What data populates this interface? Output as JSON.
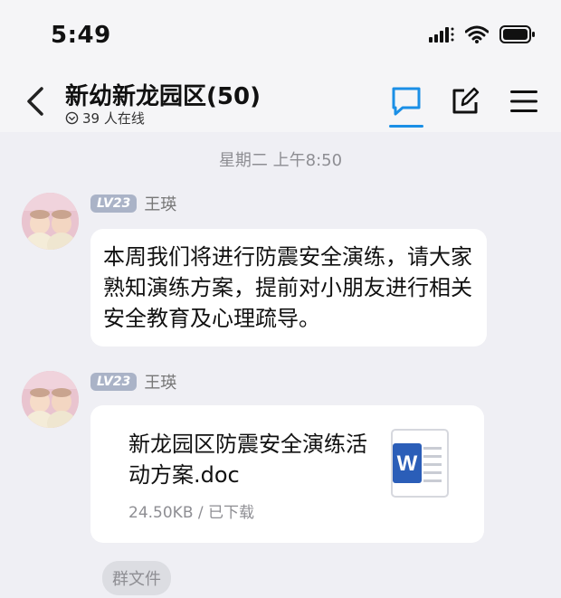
{
  "status_bar": {
    "time": "5:49"
  },
  "header": {
    "title": "新幼新龙园区(50)",
    "online": "39 人在线"
  },
  "timestamp": "星期二 上午8:50",
  "messages": [
    {
      "level": "LV23",
      "sender": "王瑛",
      "text": "本周我们将进行防震安全演练，请大家熟知演练方案，提前对小朋友进行相关安全教育及心理疏导。"
    },
    {
      "level": "LV23",
      "sender": "王瑛",
      "file": {
        "name": "新龙园区防震安全演练活动方案.doc",
        "meta": "24.50KB / 已下载",
        "icon": "word-doc-icon"
      }
    }
  ],
  "group_files_label": "群文件",
  "colors": {
    "accent": "#1a8fe6",
    "word_blue": "#2b5eb8",
    "badge": "#aab3c7"
  }
}
